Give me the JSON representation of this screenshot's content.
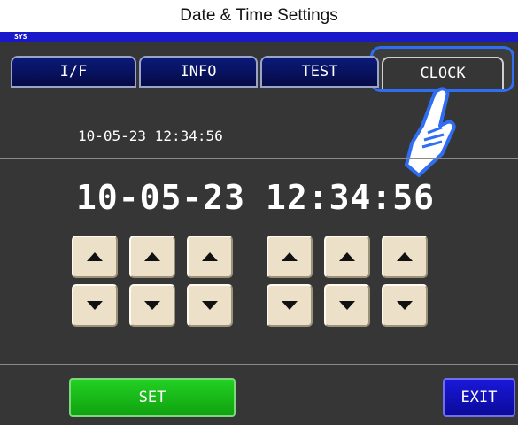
{
  "window": {
    "title": "Date & Time Settings"
  },
  "status": {
    "mode_label": "SYS"
  },
  "tabs": [
    {
      "label": "I/F"
    },
    {
      "label": "INFO"
    },
    {
      "label": "TEST"
    },
    {
      "label": "CLOCK"
    }
  ],
  "current": {
    "datetime": "10-05-23 12:34:56"
  },
  "editor": {
    "date": "10-05-23",
    "time": "12:34:56"
  },
  "buttons": {
    "set": "SET",
    "exit": "EXIT"
  },
  "colors": {
    "screen_bg": "#363636",
    "tab_highlight": "#2f6df2",
    "set_button": "#10a210",
    "exit_button": "#0b0a9a"
  }
}
